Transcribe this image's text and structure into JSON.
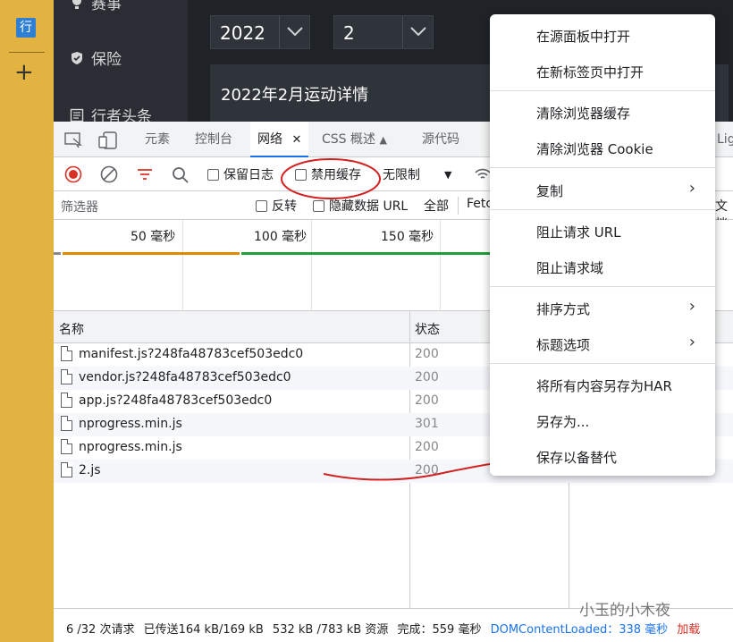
{
  "left_strip": {
    "tile_label": "行",
    "plus_label": "+"
  },
  "app": {
    "sidebar": [
      {
        "label": "赛事",
        "icon": "trophy-icon"
      },
      {
        "label": "保险",
        "icon": "shield-icon"
      },
      {
        "label": "行者头条",
        "icon": "news-icon"
      }
    ],
    "year_select": "2022",
    "month_select": "2",
    "detail_title": "2022年2月运动详情"
  },
  "devtools": {
    "tabs": [
      {
        "label": "元素"
      },
      {
        "label": "控制台"
      },
      {
        "label": "网络",
        "active": true
      },
      {
        "label": "CSS 概述"
      },
      {
        "label": "源代码"
      },
      {
        "label": "Lig"
      }
    ],
    "toolbar": {
      "preserve_log": "保留日志",
      "disable_cache": "禁用缓存",
      "throttle": "无限制"
    },
    "filter": {
      "placeholder": "筛选器",
      "invert": "反转",
      "hide_data_urls": "隐藏数据 URL",
      "all": "全部",
      "fetch": "Fetc",
      "doc": "文档"
    },
    "timeline_ticks": [
      "50 毫秒",
      "100 毫秒",
      "150 毫秒"
    ],
    "columns": {
      "name": "名称",
      "status": "状态"
    },
    "rows": [
      {
        "name": "manifest.js?248fa48783cef503edc0",
        "status": "200"
      },
      {
        "name": "vendor.js?248fa48783cef503edc0",
        "status": "200"
      },
      {
        "name": "app.js?248fa48783cef503edc0",
        "status": "200"
      },
      {
        "name": "nprogress.min.js",
        "status": "301"
      },
      {
        "name": "nprogress.min.js",
        "status": "200"
      },
      {
        "name": "2.js",
        "status": "200"
      }
    ],
    "status_bar": {
      "requests": "6 /32 次请求",
      "transferred": "已传送164 kB/169 kB",
      "resources": "532 kB /783 kB 资源",
      "finish": "完成：559 毫秒",
      "dcl": "DOMContentLoaded：338 毫秒",
      "load": "加载"
    }
  },
  "context_menu": [
    {
      "label": "在源面板中打开"
    },
    {
      "label": "在新标签页中打开"
    },
    {
      "label": "清除浏览器缓存"
    },
    {
      "label": "清除浏览器 Cookie"
    },
    {
      "label": "复制",
      "submenu": true
    },
    {
      "label": "阻止请求 URL"
    },
    {
      "label": "阻止请求域"
    },
    {
      "label": "排序方式",
      "submenu": true
    },
    {
      "label": "标题选项",
      "submenu": true
    },
    {
      "label": "将所有内容另存为HAR"
    },
    {
      "label": "另存为..."
    },
    {
      "label": "保存以备替代"
    }
  ],
  "watermark": "小玉的小木夜",
  "colors": {
    "annotation": "#d32020",
    "accent": "#1a73e8",
    "strip": "#e3b341"
  }
}
